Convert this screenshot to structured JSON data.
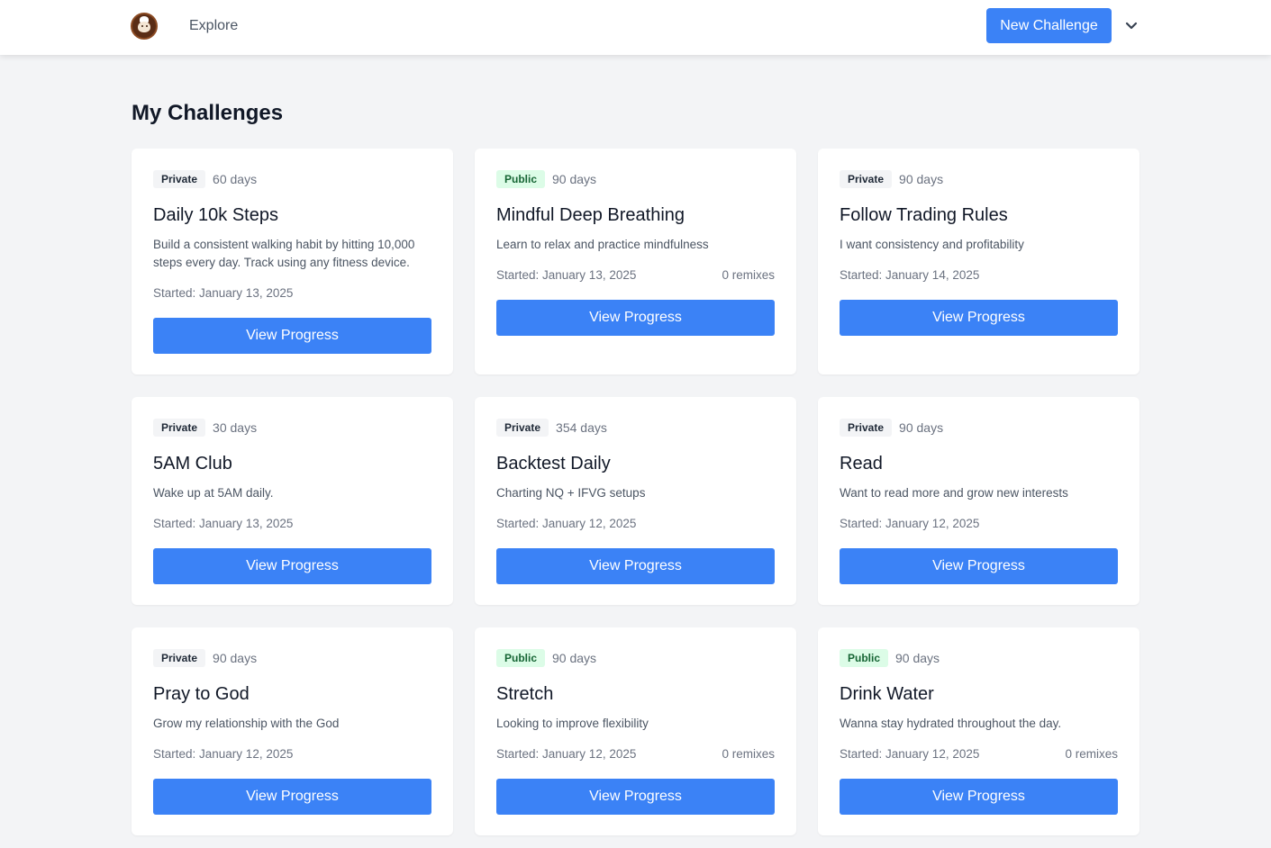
{
  "nav": {
    "explore_label": "Explore",
    "new_challenge_label": "New Challenge",
    "menu_icon": "chevron-down-icon",
    "logo_icon": "chef-avatar-logo"
  },
  "page_title": "My Challenges",
  "colors": {
    "accent": "#3b82f6",
    "public_badge_bg": "#dcfce7",
    "public_badge_text": "#166534",
    "private_badge_bg": "#f3f4f6"
  },
  "challenges": [
    {
      "visibility": "Private",
      "duration": "60 days",
      "title": "Daily 10k Steps",
      "description": "Build a consistent walking habit by hitting 10,000 steps every day. Track using any fitness device.",
      "started": "Started: January 13, 2025",
      "remixes": "",
      "button_label": "View Progress"
    },
    {
      "visibility": "Public",
      "duration": "90 days",
      "title": "Mindful Deep Breathing",
      "description": "Learn to relax and practice mindfulness",
      "started": "Started: January 13, 2025",
      "remixes": "0 remixes",
      "button_label": "View Progress"
    },
    {
      "visibility": "Private",
      "duration": "90 days",
      "title": "Follow Trading Rules",
      "description": "I want consistency and profitability",
      "started": "Started: January 14, 2025",
      "remixes": "",
      "button_label": "View Progress"
    },
    {
      "visibility": "Private",
      "duration": "30 days",
      "title": "5AM Club",
      "description": "Wake up at 5AM daily.",
      "started": "Started: January 13, 2025",
      "remixes": "",
      "button_label": "View Progress"
    },
    {
      "visibility": "Private",
      "duration": "354 days",
      "title": "Backtest Daily",
      "description": "Charting NQ + IFVG setups",
      "started": "Started: January 12, 2025",
      "remixes": "",
      "button_label": "View Progress"
    },
    {
      "visibility": "Private",
      "duration": "90 days",
      "title": "Read",
      "description": "Want to read more and grow new interests",
      "started": "Started: January 12, 2025",
      "remixes": "",
      "button_label": "View Progress"
    },
    {
      "visibility": "Private",
      "duration": "90 days",
      "title": "Pray to God",
      "description": "Grow my relationship with the God",
      "started": "Started: January 12, 2025",
      "remixes": "",
      "button_label": "View Progress"
    },
    {
      "visibility": "Public",
      "duration": "90 days",
      "title": "Stretch",
      "description": "Looking to improve flexibility",
      "started": "Started: January 12, 2025",
      "remixes": "0 remixes",
      "button_label": "View Progress"
    },
    {
      "visibility": "Public",
      "duration": "90 days",
      "title": "Drink Water",
      "description": "Wanna stay hydrated throughout the day.",
      "started": "Started: January 12, 2025",
      "remixes": "0 remixes",
      "button_label": "View Progress"
    }
  ]
}
